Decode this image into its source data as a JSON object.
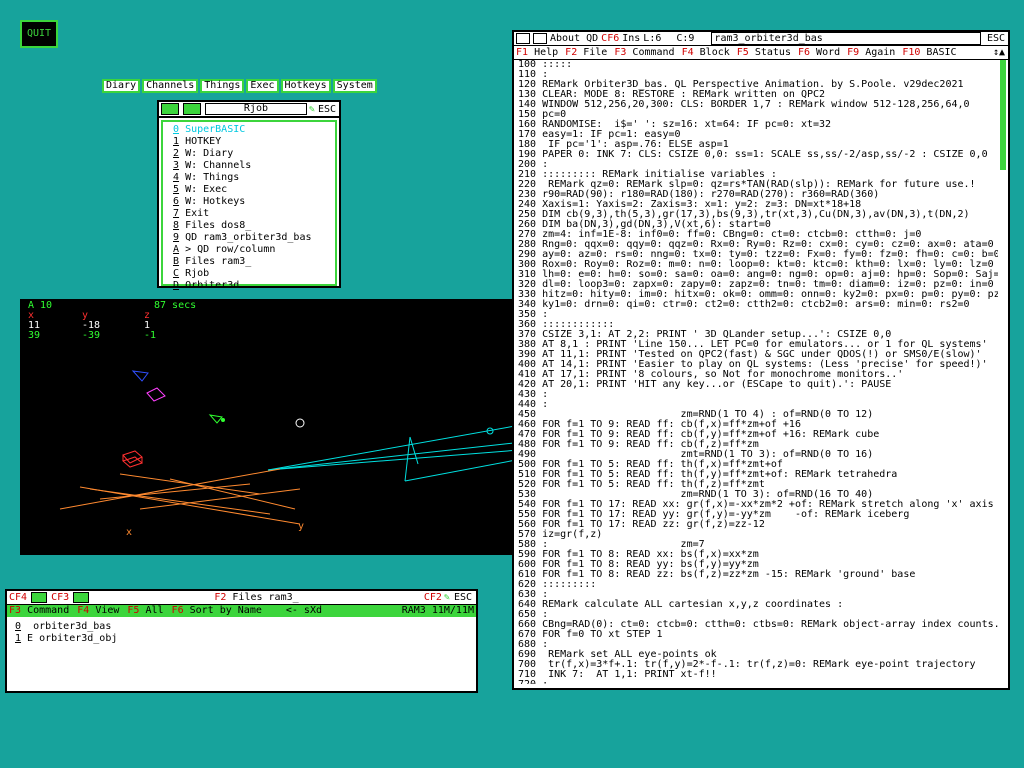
{
  "quit_label": "QUIT",
  "menubar": [
    "Diary",
    "Channels",
    "Things",
    "Exec",
    "Hotkeys",
    "System"
  ],
  "jobwin": {
    "title": "Rjob",
    "esc": "ESC",
    "items": [
      {
        "key": "0",
        "label": "SuperBASIC"
      },
      {
        "key": "1",
        "label": "HOTKEY"
      },
      {
        "key": "2",
        "label": "W: Diary"
      },
      {
        "key": "3",
        "label": "W: Channels"
      },
      {
        "key": "4",
        "label": "W: Things"
      },
      {
        "key": "5",
        "label": "W: Exec"
      },
      {
        "key": "6",
        "label": "W: Hotkeys"
      },
      {
        "key": "7",
        "label": "Exit"
      },
      {
        "key": "8",
        "label": "Files dos8_"
      },
      {
        "key": "9",
        "label": "QD ram3_orbiter3d_bas"
      },
      {
        "key": "A",
        "label": "> QD row/column"
      },
      {
        "key": "B",
        "label": "Files ram3_"
      },
      {
        "key": "C",
        "label": "Rjob"
      },
      {
        "key": "D",
        "label": "Orbiter3d"
      }
    ]
  },
  "graphic": {
    "header_left": "A 10",
    "header_right": "87 secs",
    "cols": [
      "x",
      "y",
      "z"
    ],
    "row1": [
      "11",
      "-18",
      "1"
    ],
    "row2": [
      "39",
      "-39",
      "-1"
    ],
    "axis_x": "x",
    "axis_y": "y",
    "colors": {
      "cyan": "#00e0e0",
      "red": "#ff3030",
      "orange": "#ff8a30",
      "green": "#30ff30",
      "blue": "#3050ff",
      "magenta": "#ff40ff",
      "white": "#ffffff"
    }
  },
  "fileswin": {
    "title": "Files ram3_",
    "esc": "ESC",
    "keys_top": [
      "CF4",
      "CF3"
    ],
    "key_f2": "F2",
    "key_cf2": "CF2",
    "menu": [
      {
        "key": "F3",
        "label": "Command"
      },
      {
        "key": "F4",
        "label": "View"
      },
      {
        "key": "F5",
        "label": "All"
      },
      {
        "key": "F6",
        "label": "Sort by Name"
      }
    ],
    "nav": "<- sXd",
    "device": "RAM3 11M/11M",
    "files": [
      {
        "num": "0",
        "label": "  orbiter3d_bas"
      },
      {
        "num": "1",
        "label": " E orbiter3d_obj"
      }
    ]
  },
  "editwin": {
    "about": "About QD",
    "cf6": "CF6",
    "ins": "Ins",
    "line": "L:6",
    "col": "C:9",
    "filename": "ram3_orbiter3d_bas",
    "esc": "ESC",
    "menu": [
      {
        "key": "F1",
        "label": "Help"
      },
      {
        "key": "F2",
        "label": "File"
      },
      {
        "key": "F3",
        "label": "Command"
      },
      {
        "key": "F4",
        "label": "Block"
      },
      {
        "key": "F5",
        "label": "Status"
      },
      {
        "key": "F6",
        "label": "Word"
      },
      {
        "key": "F9",
        "label": "Again"
      },
      {
        "key": "F10",
        "label": "BASIC"
      }
    ],
    "code": [
      "100 :::::",
      "110 :",
      "120 REMark Orbiter3D_bas. QL Perspective Animation. by S.Poole. v29dec2021",
      "130 CLEAR: MODE 8: RESTORE : REMark written on QPC2",
      "140 WINDOW 512,256,20,300: CLS: BORDER 1,7 : REMark window 512-128,256,64,0",
      "150 pc=0",
      "160 RANDOMISE:  i$=' ': sz=16: xt=64: IF pc=0: xt=32",
      "170 easy=1: IF pc=1: easy=0",
      "180  IF pc='1': asp=.76: ELSE asp=1",
      "190 PAPER 0: INK 7: CLS: CSIZE 0,0: ss=1: SCALE ss,ss/-2/asp,ss/-2 : CSIZE 0,0",
      "200 :",
      "210 ::::::::: REMark initialise variables :",
      "220  REMark qz=0: REMark slp=0: qz=rs*TAN(RAD(slp)): REMark for future use.!",
      "230 r90=RAD(90): r180=RAD(180): r270=RAD(270): r360=RAD(360)",
      "240 Xaxis=1: Yaxis=2: Zaxis=3: x=1: y=2: z=3: DN=xt*18+18",
      "250 DIM cb(9,3),th(5,3),gr(17,3),bs(9,3),tr(xt,3),Cu(DN,3),av(DN,3),t(DN,2)",
      "260 DIM ba(DN,3),gd(DN,3),V(xt,6): start=0",
      "270 zm=4: inf=1E-8: inf0=0: ff=0: CBng=0: ct=0: ctcb=0: ctth=0: j=0",
      "280 Rng=0: qqx=0: qqy=0: qqz=0: Rx=0: Ry=0: Rz=0: cx=0: cy=0: cz=0: ax=0: ata=0",
      "290 ay=0: az=0: rs=0: nng=0: tx=0: ty=0: tzz=0: Fx=0: fy=0: fz=0: fh=0: c=0: b=0",
      "300 Rox=0: Roy=0: Roz=0: m=0: n=0: loop=0: kt=0: ktc=0: kth=0: lx=0: ly=0: lz=0",
      "310 lh=0: e=0: h=0: so=0: sa=0: oa=0: ang=0: ng=0: op=0: aj=0: hp=0: Sop=0: Saj=",
      "320 dl=0: loop3=0: zapx=0: zapy=0: zapz=0: tn=0: tm=0: diam=0: iz=0: pz=0: in=0",
      "330 hitz=0: hity=0: im=0: hitx=0: ok=0: omm=0: onn=0: ky2=0: px=0: p=0: py=0: pz",
      "340 ky1=0: drn=0: qi=0: ctr=0: ct2=0: ctth2=0: ctcb2=0: ars=0: min=0: rs2=0",
      "350 :",
      "360 ::::::::::::",
      "370 CSIZE 3,1: AT 2,2: PRINT ' 3D QLander setup...': CSIZE 0,0",
      "380 AT 8,1 : PRINT 'Line 150... LET PC=0 for emulators... or 1 for QL systems'",
      "390 AT 11,1: PRINT 'Tested on QPC2(fast) & SGC under QDOS(!) or SMS0/E(slow)'",
      "400 AT 14,1: PRINT 'Easier to play on QL systems: (Less 'precise' for speed!)'",
      "410 AT 17,1: PRINT '8 colours, so Not for monochrome monitors..'",
      "420 AT 20,1: PRINT 'HIT any key...or (ESCape to quit).': PAUSE",
      "430 :",
      "440 :",
      "450                        zm=RND(1 TO 4) : of=RND(0 TO 12)",
      "460 FOR f=1 TO 9: READ ff: cb(f,x)=ff*zm+of +16",
      "470 FOR f=1 TO 9: READ ff: cb(f,y)=ff*zm+of +16: REMark cube",
      "480 FOR f=1 TO 9: READ ff: cb(f,z)=ff*zm",
      "490                        zmt=RND(1 TO 3): of=RND(0 TO 16)",
      "500 FOR f=1 TO 5: READ ff: th(f,x)=ff*zmt+of",
      "510 FOR f=1 TO 5: READ ff: th(f,y)=ff*zmt+of: REMark tetrahedra",
      "520 FOR f=1 TO 5: READ ff: th(f,z)=ff*zmt",
      "530                        zm=RND(1 TO 3): of=RND(16 TO 40)",
      "540 FOR f=1 TO 17: READ xx: gr(f,x)=-xx*zm*2 +of: REMark stretch along 'x' axis",
      "550 FOR f=1 TO 17: READ yy: gr(f,y)=-yy*zm    -of: REMark iceberg",
      "560 FOR f=1 TO 17: READ zz: gr(f,z)=zz-12",
      "570 iz=gr(f,z)",
      "580 :                      zm=7",
      "590 FOR f=1 TO 8: READ xx: bs(f,x)=xx*zm",
      "600 FOR f=1 TO 8: READ yy: bs(f,y)=yy*zm",
      "610 FOR f=1 TO 8: READ zz: bs(f,z)=zz*zm -15: REMark 'ground' base",
      "620 :::::::::",
      "630 :",
      "640 REMark calculate ALL cartesian x,y,z coordinates :",
      "650 :",
      "660 CBng=RAD(0): ct=0: ctcb=0: ctth=0: ctbs=0: REMark object-array index counts.",
      "670 FOR f=0 TO xt STEP 1",
      "680 :",
      "690  REMark set ALL eye-points ok",
      "700  tr(f,x)=3*f+.1: tr(f,y)=2*-f-.1: tr(f,z)=0: REMark eye-point trajectory",
      "710  INK 7:  AT 1,1: PRINT xt-f!!",
      "720 :",
      "730 FOR j=1 TO 17"
    ]
  }
}
